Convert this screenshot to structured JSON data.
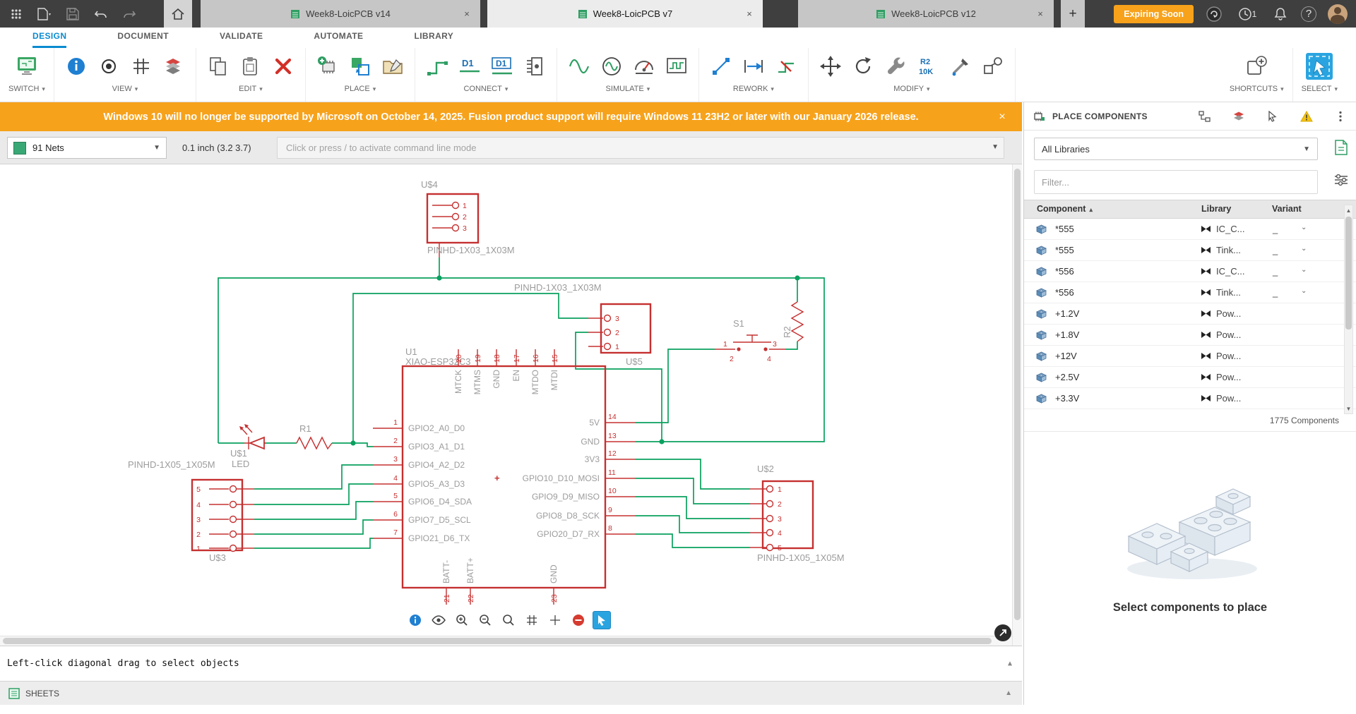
{
  "titlebar": {
    "tabs": [
      {
        "label": "Week8-LoicPCB v14"
      },
      {
        "label": "Week8-LoicPCB v7"
      },
      {
        "label": "Week8-LoicPCB v12"
      }
    ],
    "close_glyph": "×",
    "new_tab_glyph": "+",
    "expiring_badge": "Expiring Soon",
    "notification_count": "1",
    "help_glyph": "?"
  },
  "menu": {
    "items": [
      {
        "label": "DESIGN"
      },
      {
        "label": "DOCUMENT"
      },
      {
        "label": "VALIDATE"
      },
      {
        "label": "AUTOMATE"
      },
      {
        "label": "LIBRARY"
      }
    ]
  },
  "ribbon": {
    "groups": [
      {
        "label": "SWITCH"
      },
      {
        "label": "VIEW"
      },
      {
        "label": "EDIT"
      },
      {
        "label": "PLACE"
      },
      {
        "label": "CONNECT"
      },
      {
        "label": "SIMULATE"
      },
      {
        "label": "REWORK"
      },
      {
        "label": "MODIFY"
      },
      {
        "label": "SHORTCUTS"
      },
      {
        "label": "SELECT"
      }
    ],
    "icon_text": {
      "net_label": "D1",
      "net_label_boxed": "D1",
      "value_ref": "R2",
      "value_val": "10K"
    }
  },
  "banner": {
    "message": "Windows 10 will no longer be supported by Microsoft on October 14, 2025. Fusion product support will require Windows 11 23H2 or later with our January 2026 release.",
    "close_glyph": "×"
  },
  "command_bar": {
    "net_selector": "91 Nets",
    "coordinates": "0.1 inch (3.2 3.7)",
    "placeholder": "Click or press / to activate command line mode"
  },
  "schematic": {
    "u4": {
      "ref": "U$4",
      "value": "PINHD-1X03_1X03M",
      "pins": [
        "1",
        "2",
        "3"
      ]
    },
    "u5": {
      "ref": "U$5",
      "value": "PINHD-1X03_1X03M",
      "pins": [
        "3",
        "2",
        "1"
      ]
    },
    "u3": {
      "ref": "U$3",
      "value": "PINHD-1X05_1X05M",
      "pins": [
        "5",
        "4",
        "3",
        "2",
        "1"
      ]
    },
    "u2": {
      "ref": "U$2",
      "value": "PINHD-1X05_1X05M",
      "pins": [
        "1",
        "2",
        "3",
        "4",
        "5"
      ]
    },
    "s1": {
      "ref": "S1",
      "pins": [
        "1",
        "2",
        "3",
        "4"
      ]
    },
    "r1": {
      "ref": "R1"
    },
    "r2": {
      "ref": "R2"
    },
    "led": {
      "ref": "U$1",
      "value": "LED"
    },
    "plus_mark": "+",
    "u1": {
      "ref": "U1",
      "value": "XIAO-ESP32C3",
      "left": [
        {
          "n": "1",
          "label": "GPIO2_A0_D0"
        },
        {
          "n": "2",
          "label": "GPIO3_A1_D1"
        },
        {
          "n": "3",
          "label": "GPIO4_A2_D2"
        },
        {
          "n": "4",
          "label": "GPIO5_A3_D3"
        },
        {
          "n": "5",
          "label": "GPIO6_D4_SDA"
        },
        {
          "n": "6",
          "label": "GPIO7_D5_SCL"
        },
        {
          "n": "7",
          "label": "GPIO21_D6_TX"
        }
      ],
      "right": [
        {
          "n": "14",
          "label": "5V"
        },
        {
          "n": "13",
          "label": "GND"
        },
        {
          "n": "12",
          "label": "3V3"
        },
        {
          "n": "11",
          "label": "GPIO10_D10_MOSI"
        },
        {
          "n": "10",
          "label": "GPIO9_D9_MISO"
        },
        {
          "n": "9",
          "label": "GPIO8_D8_SCK"
        },
        {
          "n": "8",
          "label": "GPIO20_D7_RX"
        }
      ],
      "top": [
        {
          "n": "20",
          "label": "MTCK"
        },
        {
          "n": "19",
          "label": "MTMS"
        },
        {
          "n": "18",
          "label": "GND"
        },
        {
          "n": "17",
          "label": "EN"
        },
        {
          "n": "16",
          "label": "MTDO"
        },
        {
          "n": "15",
          "label": "MTDI"
        }
      ],
      "bottom": [
        {
          "n": "21",
          "label": "BATT-"
        },
        {
          "n": "22",
          "label": "BATT+"
        },
        {
          "n": "23",
          "label": "GND"
        }
      ]
    }
  },
  "right_panel": {
    "title": "PLACE COMPONENTS",
    "libraries_dropdown": "All Libraries",
    "filter_placeholder": "Filter...",
    "columns": [
      {
        "label": "Component"
      },
      {
        "label": "Library"
      },
      {
        "label": "Variant"
      }
    ],
    "rows": [
      {
        "name": "*555",
        "library": "IC_C...",
        "variant": "_"
      },
      {
        "name": "*555",
        "library": "Tink...",
        "variant": "_"
      },
      {
        "name": "*556",
        "library": "IC_C...",
        "variant": "_"
      },
      {
        "name": "*556",
        "library": "Tink...",
        "variant": "_"
      },
      {
        "name": "+1.2V",
        "library": "Pow...",
        "variant": ""
      },
      {
        "name": "+1.8V",
        "library": "Pow...",
        "variant": ""
      },
      {
        "name": "+12V",
        "library": "Pow...",
        "variant": ""
      },
      {
        "name": "+2.5V",
        "library": "Pow...",
        "variant": ""
      },
      {
        "name": "+3.3V",
        "library": "Pow...",
        "variant": ""
      }
    ],
    "count": "1775 Components",
    "empty_state": "Select components to place"
  },
  "status_bar": {
    "message": "Left-click diagonal drag to select objects"
  },
  "sheets_bar": {
    "label": "SHEETS"
  }
}
